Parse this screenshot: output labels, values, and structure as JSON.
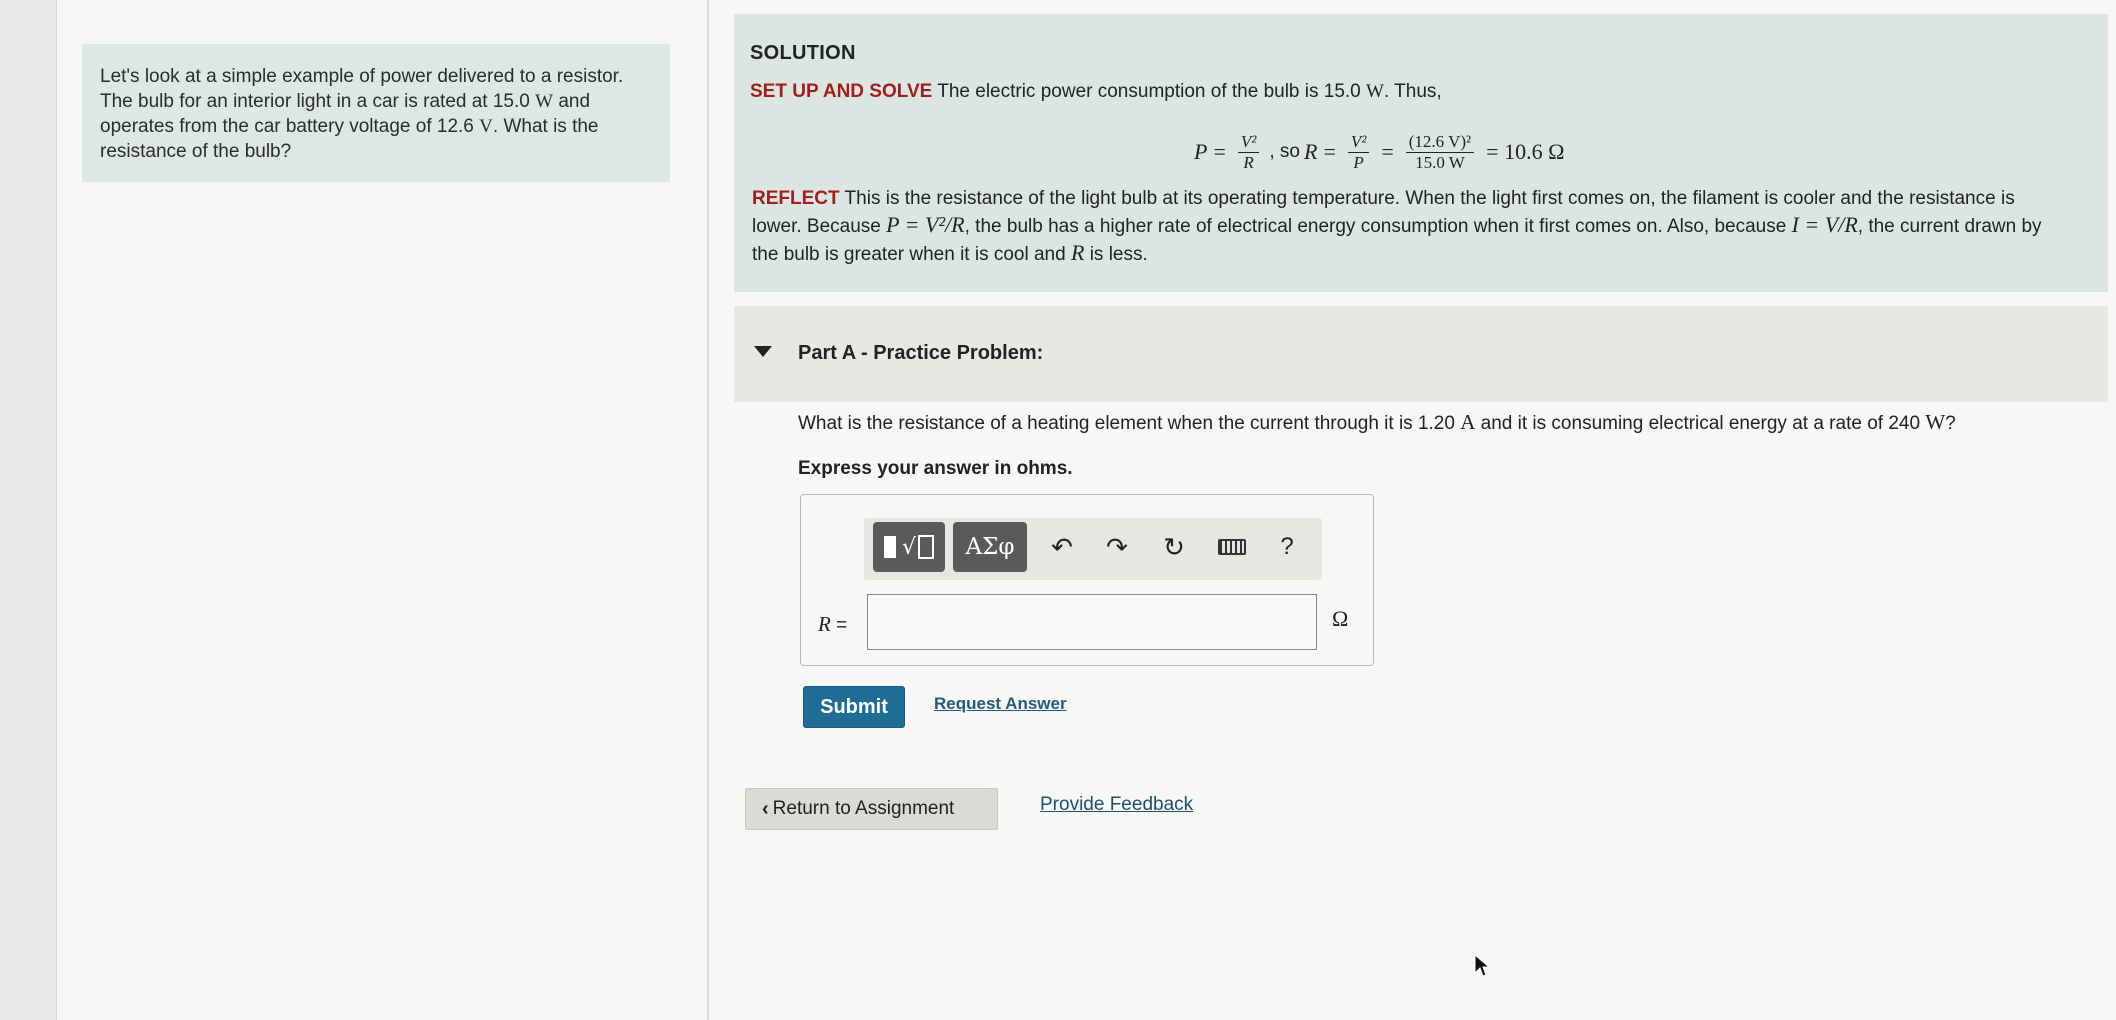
{
  "intro": {
    "line1": "Let's look at a simple example of power delivered to a resistor.",
    "line2_a": "The bulb for an interior light in a car is rated at 15.0",
    "line2_unit": "W",
    "line2_b": "and",
    "line3_a": "operates from the car battery voltage of 12.6",
    "line3_unit": "V",
    "line3_b": ". What is the",
    "line4": "resistance of the bulb?"
  },
  "solution": {
    "title": "SOLUTION",
    "setup_label": "SET UP AND SOLVE",
    "setup_text": "The electric power consumption of the bulb is 15.0",
    "setup_unit": "W",
    "setup_tail": ". Thus,",
    "eq": {
      "p": "P",
      "eq": "=",
      "v2": "V²",
      "r": "R",
      "so": ", so",
      "r2": "R",
      "p2": "P",
      "num": "(12.6 V)²",
      "den": "15.0 W",
      "result": "= 10.6 Ω"
    },
    "reflect_label": "REFLECT",
    "reflect_1": "This is the resistance of the light bulb at its operating temperature. When the light first comes on, the filament is cooler and the resistance is",
    "reflect_2a": "lower. Because",
    "reflect_2_math": "P = V²/R",
    "reflect_2b": ", the bulb has a higher rate of electrical energy consumption when it first comes on. Also, because",
    "reflect_2_math2": "I = V/R",
    "reflect_2c": ", the current",
    "reflect_3a": "drawn by the bulb is greater when it is cool and",
    "reflect_3_math": "R",
    "reflect_3b": "is less."
  },
  "part_a": {
    "title": "Part A - Practice Problem:",
    "question_a": "What is the resistance of a heating element when the current through it is 1.20",
    "question_unit1": "A",
    "question_b": "and it is consuming electrical energy at a rate of 240",
    "question_unit2": "W",
    "question_c": "?",
    "express": "Express your answer in ohms.",
    "toolbar": {
      "templates_icon": "templates-icon",
      "greek_label": "ΑΣφ",
      "undo_icon": "undo-icon",
      "redo_icon": "redo-icon",
      "reset_icon": "reset-icon",
      "keyboard_icon": "keyboard-icon",
      "help_label": "?"
    },
    "var_label": "R",
    "var_eq": "=",
    "input_value": "",
    "unit": "Ω",
    "submit_label": "Submit",
    "request_label": "Request Answer"
  },
  "footer": {
    "return_label": "Return to Assignment",
    "feedback_label": "Provide Feedback"
  },
  "colors": {
    "solution_bg": "#dbe6e2",
    "intro_bg": "#dde8e4",
    "label_red": "#a31d1d",
    "submit_blue": "#1f6d94"
  }
}
